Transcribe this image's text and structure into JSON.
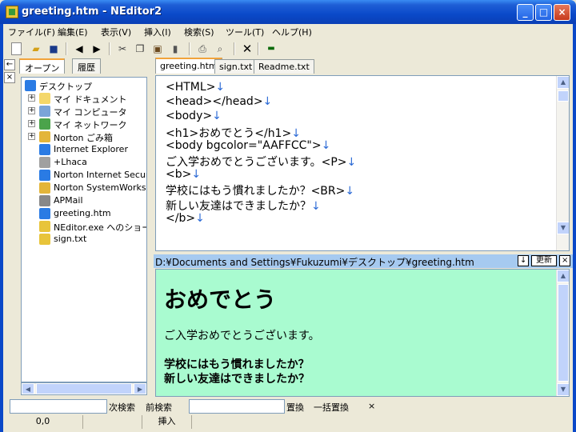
{
  "window": {
    "title": "greeting.htm - NEditor2"
  },
  "menu": [
    "ファイル(F)",
    "編集(E)",
    "表示(V)",
    "挿入(I)",
    "検索(S)",
    "ツール(T)",
    "ヘルプ(H)"
  ],
  "left_tabs": {
    "open": "オープン",
    "history": "履歴"
  },
  "tree": {
    "root": "デスクトップ",
    "items": [
      {
        "label": "マイ ドキュメント",
        "icon": "my-documents-icon",
        "color": "#f4d76a"
      },
      {
        "label": "マイ コンピュータ",
        "icon": "my-computer-icon",
        "color": "#7aa4d8"
      },
      {
        "label": "マイ ネットワーク",
        "icon": "my-network-icon",
        "color": "#4ba34b"
      },
      {
        "label": "Norton ごみ箱",
        "icon": "recycle-bin-icon",
        "color": "#e3b53a"
      },
      {
        "label": "Internet Explorer",
        "icon": "internet-explorer-icon",
        "color": "#2a7be4"
      },
      {
        "label": "+Lhaca",
        "icon": "lhaca-icon",
        "color": "#a0a0a0"
      },
      {
        "label": "Norton Internet Securi",
        "icon": "norton-internet-security-icon",
        "color": "#2a7be4"
      },
      {
        "label": "Norton SystemWorks",
        "icon": "norton-systemworks-icon",
        "color": "#e3b53a"
      },
      {
        "label": "APMail",
        "icon": "apmail-icon",
        "color": "#888888"
      },
      {
        "label": "greeting.htm",
        "icon": "html-file-icon",
        "color": "#2a7be4"
      },
      {
        "label": "NEditor.exe へのショー",
        "icon": "neditor-shortcut-icon",
        "color": "#e8c43a"
      },
      {
        "label": "sign.txt",
        "icon": "text-file-icon",
        "color": "#e8c43a"
      }
    ]
  },
  "editor_tabs": [
    "greeting.htm",
    "sign.txt",
    "Readme.txt"
  ],
  "editor": {
    "lines": [
      "<HTML>",
      "<head></head>",
      "<body>",
      "<h1>おめでとう</h1>",
      "<body bgcolor=\"AAFFCC\">",
      "ご入学おめでとうございます。<P>",
      "<b>",
      "学校にはもう慣れましたか？<BR>",
      "新しい友達はできましたか？",
      "</b>"
    ],
    "eol_mark": "↓"
  },
  "preview": {
    "path": "D:¥Documents and Settings¥Fukuzumi¥デスクトップ¥greeting.htm",
    "down_label": "↓",
    "refresh_label": "更新",
    "close_label": "×",
    "heading": "おめでとう",
    "paragraph": "ご入学おめでとうございます。",
    "bold_line1": "学校にはもう慣れましたか？",
    "bold_line2": "新しい友達はできましたか？",
    "bg_color": "#aaffcc"
  },
  "search": {
    "find_next": "次検索",
    "find_prev": "前検索",
    "replace": "置換",
    "replace_all": "一括置換",
    "close": "×"
  },
  "status": {
    "position": "0,0",
    "mode": "挿入"
  },
  "colors": {
    "title_bar": "#0a49c9",
    "accent_tab": "#f1a33b"
  }
}
